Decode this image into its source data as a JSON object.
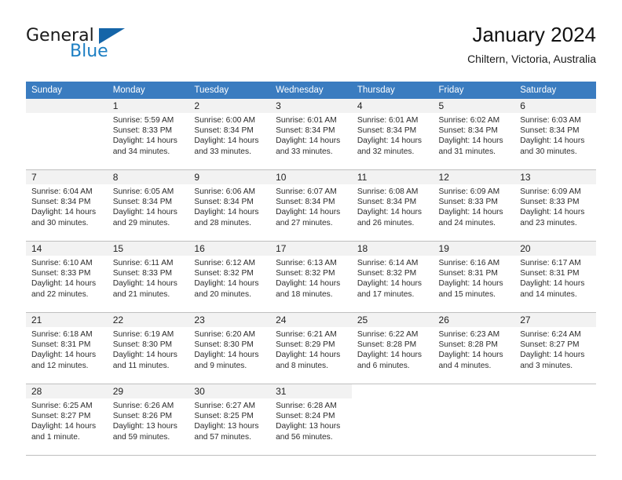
{
  "brand": {
    "line1": "General",
    "line2": "Blue",
    "triangle_icon": "brand-triangle-icon",
    "accent_color": "#1d7fc3",
    "triangle_color": "#1565a8"
  },
  "header": {
    "title": "January 2024",
    "subtitle": "Chiltern, Victoria, Australia"
  },
  "theme": {
    "header_row_bg": "#3a7cc0",
    "daynum_strip_bg": "#f2f2f2",
    "grid_line": "#bfbfbf",
    "text": "#2b2b2b"
  },
  "weekday_headers": [
    "Sunday",
    "Monday",
    "Tuesday",
    "Wednesday",
    "Thursday",
    "Friday",
    "Saturday"
  ],
  "weeks": [
    [
      {
        "day": "",
        "sunrise": "",
        "sunset": "",
        "daylight1": "",
        "daylight2": ""
      },
      {
        "day": "1",
        "sunrise": "Sunrise: 5:59 AM",
        "sunset": "Sunset: 8:33 PM",
        "daylight1": "Daylight: 14 hours",
        "daylight2": "and 34 minutes."
      },
      {
        "day": "2",
        "sunrise": "Sunrise: 6:00 AM",
        "sunset": "Sunset: 8:34 PM",
        "daylight1": "Daylight: 14 hours",
        "daylight2": "and 33 minutes."
      },
      {
        "day": "3",
        "sunrise": "Sunrise: 6:01 AM",
        "sunset": "Sunset: 8:34 PM",
        "daylight1": "Daylight: 14 hours",
        "daylight2": "and 33 minutes."
      },
      {
        "day": "4",
        "sunrise": "Sunrise: 6:01 AM",
        "sunset": "Sunset: 8:34 PM",
        "daylight1": "Daylight: 14 hours",
        "daylight2": "and 32 minutes."
      },
      {
        "day": "5",
        "sunrise": "Sunrise: 6:02 AM",
        "sunset": "Sunset: 8:34 PM",
        "daylight1": "Daylight: 14 hours",
        "daylight2": "and 31 minutes."
      },
      {
        "day": "6",
        "sunrise": "Sunrise: 6:03 AM",
        "sunset": "Sunset: 8:34 PM",
        "daylight1": "Daylight: 14 hours",
        "daylight2": "and 30 minutes."
      }
    ],
    [
      {
        "day": "7",
        "sunrise": "Sunrise: 6:04 AM",
        "sunset": "Sunset: 8:34 PM",
        "daylight1": "Daylight: 14 hours",
        "daylight2": "and 30 minutes."
      },
      {
        "day": "8",
        "sunrise": "Sunrise: 6:05 AM",
        "sunset": "Sunset: 8:34 PM",
        "daylight1": "Daylight: 14 hours",
        "daylight2": "and 29 minutes."
      },
      {
        "day": "9",
        "sunrise": "Sunrise: 6:06 AM",
        "sunset": "Sunset: 8:34 PM",
        "daylight1": "Daylight: 14 hours",
        "daylight2": "and 28 minutes."
      },
      {
        "day": "10",
        "sunrise": "Sunrise: 6:07 AM",
        "sunset": "Sunset: 8:34 PM",
        "daylight1": "Daylight: 14 hours",
        "daylight2": "and 27 minutes."
      },
      {
        "day": "11",
        "sunrise": "Sunrise: 6:08 AM",
        "sunset": "Sunset: 8:34 PM",
        "daylight1": "Daylight: 14 hours",
        "daylight2": "and 26 minutes."
      },
      {
        "day": "12",
        "sunrise": "Sunrise: 6:09 AM",
        "sunset": "Sunset: 8:33 PM",
        "daylight1": "Daylight: 14 hours",
        "daylight2": "and 24 minutes."
      },
      {
        "day": "13",
        "sunrise": "Sunrise: 6:09 AM",
        "sunset": "Sunset: 8:33 PM",
        "daylight1": "Daylight: 14 hours",
        "daylight2": "and 23 minutes."
      }
    ],
    [
      {
        "day": "14",
        "sunrise": "Sunrise: 6:10 AM",
        "sunset": "Sunset: 8:33 PM",
        "daylight1": "Daylight: 14 hours",
        "daylight2": "and 22 minutes."
      },
      {
        "day": "15",
        "sunrise": "Sunrise: 6:11 AM",
        "sunset": "Sunset: 8:33 PM",
        "daylight1": "Daylight: 14 hours",
        "daylight2": "and 21 minutes."
      },
      {
        "day": "16",
        "sunrise": "Sunrise: 6:12 AM",
        "sunset": "Sunset: 8:32 PM",
        "daylight1": "Daylight: 14 hours",
        "daylight2": "and 20 minutes."
      },
      {
        "day": "17",
        "sunrise": "Sunrise: 6:13 AM",
        "sunset": "Sunset: 8:32 PM",
        "daylight1": "Daylight: 14 hours",
        "daylight2": "and 18 minutes."
      },
      {
        "day": "18",
        "sunrise": "Sunrise: 6:14 AM",
        "sunset": "Sunset: 8:32 PM",
        "daylight1": "Daylight: 14 hours",
        "daylight2": "and 17 minutes."
      },
      {
        "day": "19",
        "sunrise": "Sunrise: 6:16 AM",
        "sunset": "Sunset: 8:31 PM",
        "daylight1": "Daylight: 14 hours",
        "daylight2": "and 15 minutes."
      },
      {
        "day": "20",
        "sunrise": "Sunrise: 6:17 AM",
        "sunset": "Sunset: 8:31 PM",
        "daylight1": "Daylight: 14 hours",
        "daylight2": "and 14 minutes."
      }
    ],
    [
      {
        "day": "21",
        "sunrise": "Sunrise: 6:18 AM",
        "sunset": "Sunset: 8:31 PM",
        "daylight1": "Daylight: 14 hours",
        "daylight2": "and 12 minutes."
      },
      {
        "day": "22",
        "sunrise": "Sunrise: 6:19 AM",
        "sunset": "Sunset: 8:30 PM",
        "daylight1": "Daylight: 14 hours",
        "daylight2": "and 11 minutes."
      },
      {
        "day": "23",
        "sunrise": "Sunrise: 6:20 AM",
        "sunset": "Sunset: 8:30 PM",
        "daylight1": "Daylight: 14 hours",
        "daylight2": "and 9 minutes."
      },
      {
        "day": "24",
        "sunrise": "Sunrise: 6:21 AM",
        "sunset": "Sunset: 8:29 PM",
        "daylight1": "Daylight: 14 hours",
        "daylight2": "and 8 minutes."
      },
      {
        "day": "25",
        "sunrise": "Sunrise: 6:22 AM",
        "sunset": "Sunset: 8:28 PM",
        "daylight1": "Daylight: 14 hours",
        "daylight2": "and 6 minutes."
      },
      {
        "day": "26",
        "sunrise": "Sunrise: 6:23 AM",
        "sunset": "Sunset: 8:28 PM",
        "daylight1": "Daylight: 14 hours",
        "daylight2": "and 4 minutes."
      },
      {
        "day": "27",
        "sunrise": "Sunrise: 6:24 AM",
        "sunset": "Sunset: 8:27 PM",
        "daylight1": "Daylight: 14 hours",
        "daylight2": "and 3 minutes."
      }
    ],
    [
      {
        "day": "28",
        "sunrise": "Sunrise: 6:25 AM",
        "sunset": "Sunset: 8:27 PM",
        "daylight1": "Daylight: 14 hours",
        "daylight2": "and 1 minute."
      },
      {
        "day": "29",
        "sunrise": "Sunrise: 6:26 AM",
        "sunset": "Sunset: 8:26 PM",
        "daylight1": "Daylight: 13 hours",
        "daylight2": "and 59 minutes."
      },
      {
        "day": "30",
        "sunrise": "Sunrise: 6:27 AM",
        "sunset": "Sunset: 8:25 PM",
        "daylight1": "Daylight: 13 hours",
        "daylight2": "and 57 minutes."
      },
      {
        "day": "31",
        "sunrise": "Sunrise: 6:28 AM",
        "sunset": "Sunset: 8:24 PM",
        "daylight1": "Daylight: 13 hours",
        "daylight2": "and 56 minutes."
      },
      {
        "day": "",
        "sunrise": "",
        "sunset": "",
        "daylight1": "",
        "daylight2": ""
      },
      {
        "day": "",
        "sunrise": "",
        "sunset": "",
        "daylight1": "",
        "daylight2": ""
      },
      {
        "day": "",
        "sunrise": "",
        "sunset": "",
        "daylight1": "",
        "daylight2": ""
      }
    ]
  ]
}
